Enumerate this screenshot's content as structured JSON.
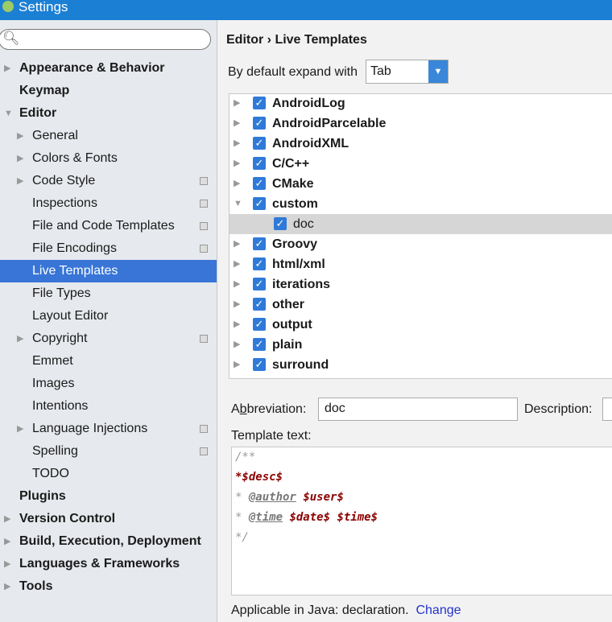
{
  "window": {
    "title": "Settings"
  },
  "sidebar": {
    "search_placeholder": "",
    "items": [
      {
        "label": "Appearance & Behavior",
        "bold": true,
        "level": 0,
        "arrow": "right"
      },
      {
        "label": "Keymap",
        "bold": true,
        "level": 0
      },
      {
        "label": "Editor",
        "bold": true,
        "level": 0,
        "arrow": "down"
      },
      {
        "label": "General",
        "level": 1,
        "arrow": "right"
      },
      {
        "label": "Colors & Fonts",
        "level": 1,
        "arrow": "right"
      },
      {
        "label": "Code Style",
        "level": 1,
        "arrow": "right",
        "project": true
      },
      {
        "label": "Inspections",
        "level": 1,
        "project": true
      },
      {
        "label": "File and Code Templates",
        "level": 1,
        "project": true
      },
      {
        "label": "File Encodings",
        "level": 1,
        "project": true
      },
      {
        "label": "Live Templates",
        "level": 1,
        "selected": true
      },
      {
        "label": "File Types",
        "level": 1
      },
      {
        "label": "Layout Editor",
        "level": 1
      },
      {
        "label": "Copyright",
        "level": 1,
        "arrow": "right",
        "project": true
      },
      {
        "label": "Emmet",
        "level": 1
      },
      {
        "label": "Images",
        "level": 1
      },
      {
        "label": "Intentions",
        "level": 1
      },
      {
        "label": "Language Injections",
        "level": 1,
        "arrow": "right",
        "project": true
      },
      {
        "label": "Spelling",
        "level": 1,
        "project": true
      },
      {
        "label": "TODO",
        "level": 1
      },
      {
        "label": "Plugins",
        "bold": true,
        "level": 0
      },
      {
        "label": "Version Control",
        "bold": true,
        "level": 0,
        "arrow": "right"
      },
      {
        "label": "Build, Execution, Deployment",
        "bold": true,
        "level": 0,
        "arrow": "right"
      },
      {
        "label": "Languages & Frameworks",
        "bold": true,
        "level": 0,
        "arrow": "right"
      },
      {
        "label": "Tools",
        "bold": true,
        "level": 0,
        "arrow": "right"
      }
    ]
  },
  "main": {
    "breadcrumb": "Editor › Live Templates",
    "expand_label": "By default expand with",
    "expand_value": "Tab",
    "tree": [
      {
        "label": "AndroidLog",
        "arrow": "right"
      },
      {
        "label": "AndroidParcelable",
        "arrow": "right"
      },
      {
        "label": "AndroidXML",
        "arrow": "right"
      },
      {
        "label": "C/C++",
        "arrow": "right"
      },
      {
        "label": "CMake",
        "arrow": "right"
      },
      {
        "label": "custom",
        "arrow": "down"
      },
      {
        "label": "doc",
        "child": true,
        "selected": true
      },
      {
        "label": "Groovy",
        "arrow": "right"
      },
      {
        "label": "html/xml",
        "arrow": "right"
      },
      {
        "label": "iterations",
        "arrow": "right"
      },
      {
        "label": "other",
        "arrow": "right"
      },
      {
        "label": "output",
        "arrow": "right"
      },
      {
        "label": "plain",
        "arrow": "right"
      },
      {
        "label": "surround",
        "arrow": "right"
      }
    ],
    "abbreviation_label": "Abbreviation:",
    "abbreviation_value": "doc",
    "description_label": "Description:",
    "template_text_label": "Template text:",
    "template_lines": [
      "/**",
      "*$desc$",
      "* @author $user$",
      "* @time $date$ $time$",
      "*/"
    ],
    "applicable": "Applicable in Java: declaration.",
    "change_link": "Change"
  },
  "colors": {
    "titlebar": "#1b7fd4",
    "selection": "#3875d7",
    "checkbox": "#2f7ad9",
    "variable": "#8b0000",
    "link": "#2233cc"
  }
}
